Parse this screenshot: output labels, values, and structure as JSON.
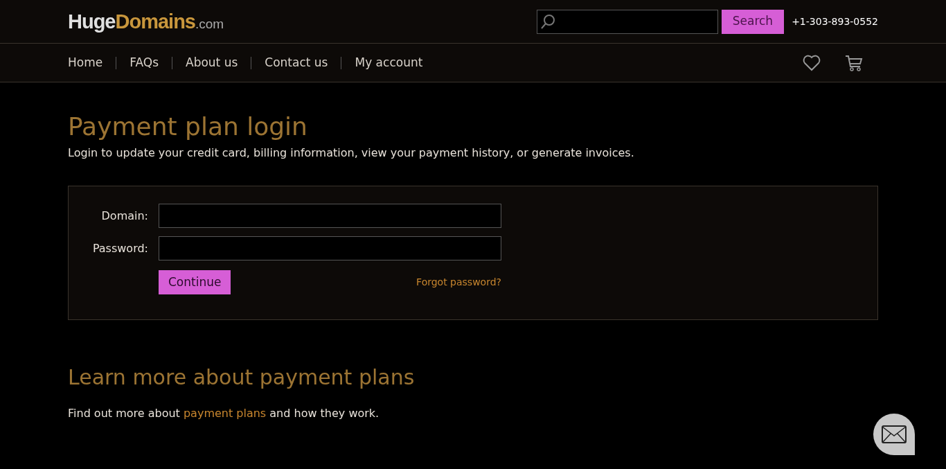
{
  "header": {
    "logo": {
      "part_1": "Huge",
      "part_2": "Domains",
      "part_3": ".com"
    },
    "search": {
      "button": "Search"
    },
    "phone": "+1-303-893-0552"
  },
  "nav": {
    "items": [
      "Home",
      "FAQs",
      "About us",
      "Contact us",
      "My account"
    ]
  },
  "login": {
    "title": "Payment plan login",
    "intro": "Login to update your credit card, billing information, view your payment history, or generate invoices.",
    "fields": [
      {
        "label": "Domain:"
      },
      {
        "label": "Password:"
      }
    ],
    "submit": "Continue",
    "forgot": "Forgot password?"
  },
  "learn": {
    "title": "Learn more about payment plans",
    "text_before": "Find out more about",
    "link": "payment plans",
    "text_after": "and how they work."
  }
}
